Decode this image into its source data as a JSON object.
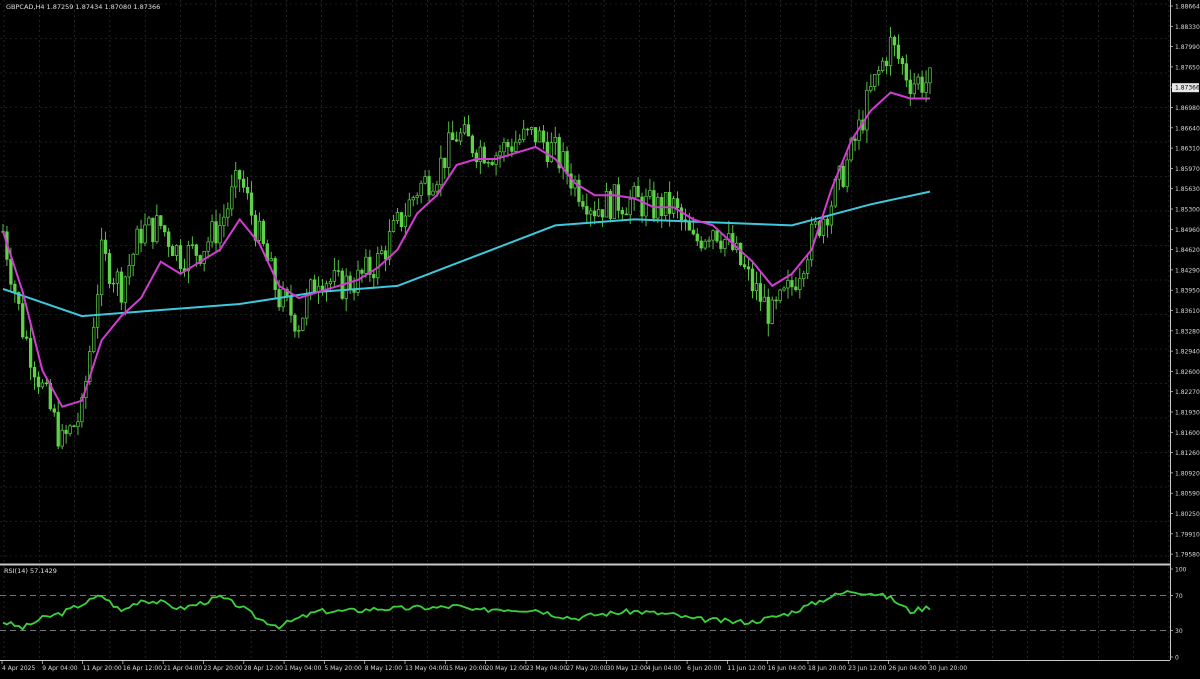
{
  "header": {
    "info": "GBPCAD,H4  1.87259 1.87434 1.87080 1.87366"
  },
  "rsi": {
    "label": "RSI(14) 57.1429",
    "levels": [
      30,
      70
    ],
    "range": [
      0,
      100
    ],
    "tick_labels": [
      "100",
      "70",
      "30",
      "0"
    ]
  },
  "colors": {
    "background": "#000000",
    "grid": "#3a3a3a",
    "candle": "#5fd24a",
    "fast_ma": "#d23cd2",
    "slow_ma": "#3ec8dc",
    "rsi_line": "#3ad23a",
    "axis_text": "#d8d8d8",
    "price_tag_bg": "#e8e8e8"
  },
  "price_axis": {
    "labels": [
      "1.88664",
      "1.88330",
      "1.87990",
      "1.87650",
      "1.87366",
      "1.86980",
      "1.86640",
      "1.86310",
      "1.85970",
      "1.85630",
      "1.85300",
      "1.84960",
      "1.84620",
      "1.84290",
      "1.83950",
      "1.83610",
      "1.83280",
      "1.82940",
      "1.82600",
      "1.82270",
      "1.81930",
      "1.81600",
      "1.81260",
      "1.80920",
      "1.80590",
      "1.80250",
      "1.79910",
      "1.79580"
    ],
    "current": "1.87366"
  },
  "time_axis": {
    "labels": [
      "4 Apr 2025",
      "9 Apr 04:00",
      "11 Apr 20:00",
      "16 Apr 12:00",
      "21 Apr 04:00",
      "23 Apr 20:00",
      "28 Apr 12:00",
      "1 May 04:00",
      "5 May 20:00",
      "8 May 12:00",
      "13 May 04:00",
      "15 May 20:00",
      "20 May 12:00",
      "23 May 04:00",
      "27 May 20:00",
      "30 May 12:00",
      "4 Jun 04:00",
      "6 Jun 20:00",
      "11 Jun 12:00",
      "16 Jun 04:00",
      "18 Jun 20:00",
      "23 Jun 12:00",
      "26 Jun 04:00",
      "30 Jun 20:00"
    ]
  },
  "chart_data": [
    {
      "type": "candlestick",
      "title": "GBPCAD,H4",
      "ohlc_last": {
        "open": 1.87259,
        "high": 1.87434,
        "low": 1.8708,
        "close": 1.87366
      },
      "ylim": [
        1.7958,
        1.88664
      ],
      "price_path": {
        "x_index": [
          0,
          5,
          10,
          15,
          20,
          25,
          30,
          35,
          40,
          45,
          50,
          55,
          60,
          65,
          70,
          75,
          80,
          85,
          90,
          95,
          100,
          105,
          110,
          115,
          120,
          125,
          130,
          135,
          140,
          145,
          150,
          155,
          160,
          165,
          170,
          175,
          180,
          185,
          190,
          195,
          200,
          205,
          210,
          215,
          220,
          225,
          230,
          235
        ],
        "close": [
          1.849,
          1.833,
          1.823,
          1.814,
          1.819,
          1.845,
          1.84,
          1.849,
          1.85,
          1.845,
          1.846,
          1.85,
          1.858,
          1.848,
          1.838,
          1.834,
          1.842,
          1.84,
          1.841,
          1.844,
          1.85,
          1.856,
          1.859,
          1.865,
          1.863,
          1.862,
          1.864,
          1.865,
          1.862,
          1.857,
          1.853,
          1.854,
          1.854,
          1.853,
          1.853,
          1.847,
          1.85,
          1.846,
          1.84,
          1.835,
          1.84,
          1.848,
          1.854,
          1.862,
          1.872,
          1.88,
          1.874,
          1.8737
        ]
      },
      "ma_fast": {
        "name": "",
        "x_index": [
          0,
          5,
          10,
          15,
          20,
          25,
          30,
          35,
          40,
          45,
          50,
          55,
          60,
          65,
          70,
          75,
          80,
          85,
          90,
          95,
          100,
          105,
          110,
          115,
          120,
          125,
          130,
          135,
          140,
          145,
          150,
          155,
          160,
          165,
          170,
          175,
          180,
          185,
          190,
          195,
          200,
          205,
          210,
          215,
          220,
          225,
          230,
          235
        ],
        "values": [
          1.849,
          1.839,
          1.826,
          1.82,
          1.821,
          1.831,
          1.835,
          1.838,
          1.844,
          1.842,
          1.844,
          1.846,
          1.851,
          1.847,
          1.84,
          1.838,
          1.839,
          1.84,
          1.841,
          1.843,
          1.846,
          1.852,
          1.855,
          1.86,
          1.861,
          1.861,
          1.862,
          1.863,
          1.861,
          1.857,
          1.855,
          1.855,
          1.8545,
          1.853,
          1.853,
          1.851,
          1.85,
          1.847,
          1.844,
          1.84,
          1.842,
          1.846,
          1.856,
          1.864,
          1.869,
          1.872,
          1.871,
          1.871
        ]
      },
      "ma_slow": {
        "name": "",
        "x_index": [
          0,
          20,
          40,
          60,
          80,
          100,
          120,
          140,
          160,
          180,
          200,
          220,
          235
        ],
        "values": [
          1.8395,
          1.835,
          1.836,
          1.837,
          1.839,
          1.84,
          1.845,
          1.85,
          1.851,
          1.8505,
          1.85,
          1.8535,
          1.8556
        ]
      }
    },
    {
      "type": "line",
      "title": "RSI(14)",
      "ylim": [
        0,
        100
      ],
      "series": [
        {
          "name": "RSI(14)",
          "x_index": [
            0,
            5,
            10,
            15,
            20,
            25,
            30,
            35,
            40,
            45,
            50,
            55,
            60,
            65,
            70,
            75,
            80,
            85,
            90,
            95,
            100,
            105,
            110,
            115,
            120,
            125,
            130,
            135,
            140,
            145,
            150,
            155,
            160,
            165,
            170,
            175,
            180,
            185,
            190,
            195,
            200,
            205,
            210,
            215,
            220,
            225,
            230,
            235
          ],
          "values": [
            40,
            33,
            44,
            50,
            60,
            70,
            52,
            65,
            62,
            55,
            61,
            68,
            58,
            43,
            35,
            44,
            52,
            52,
            53,
            55,
            55,
            56,
            56,
            58,
            52,
            55,
            54,
            54,
            48,
            44,
            48,
            50,
            52,
            50,
            48,
            43,
            42,
            40,
            40,
            45,
            51,
            60,
            69,
            75,
            73,
            67,
            52,
            57
          ]
        }
      ]
    }
  ]
}
